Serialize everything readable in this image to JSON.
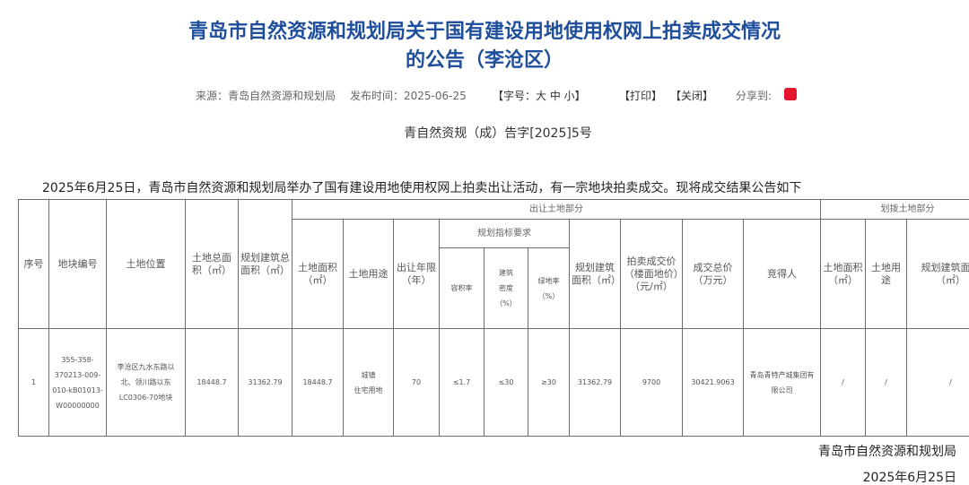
{
  "article": {
    "title_line1": "青岛市自然资源和规划局关于国有建设用地使用权网上拍卖成交情况",
    "title_line2": "的公告（李沧区）",
    "source": "来源：青岛自然资源和规划局",
    "publish_time": "发布时间：2025-06-25",
    "font_size_label": "【字号：大 中 小】",
    "print_label": "【打印】",
    "close_label": "【关闭】",
    "share_label": "分享到:",
    "share_icons": [
      "wechat-icon",
      "qzone-icon",
      "weibo-icon"
    ],
    "doc_number": "青自然资规（成）告字[2025]5号",
    "intro": "2025年6月25日，青岛市自然资源和规划局举办了国有建设用地使用权网上拍卖出让活动，有一宗地块拍卖成交。现将成交结果公告如下",
    "footer_org": "青岛市自然资源和规划局",
    "footer_date": "2025年6月25日"
  },
  "table": {
    "group_transfer": "出让土地部分",
    "group_allocate": "划拨土地部分",
    "group_planning": "规划指标要求",
    "h_seq": "序号",
    "h_parcel_no": "地块编号",
    "h_location": "土地位置",
    "h_total_area": "土地总面积（㎡）",
    "h_total_build": "规划建筑总面积（㎡）",
    "h_area": "土地面积（㎡）",
    "h_use": "土地用途",
    "h_years": "出让年限（年）",
    "h_far": "容积率",
    "h_density_a": "建筑",
    "h_density_b": "密度",
    "h_density_c": "（%）",
    "h_green_a": "绿地率",
    "h_green_b": "（%）",
    "h_build_area": "规划建筑面积（㎡）",
    "h_price": "拍卖成交价（楼面地价）（元/㎡）",
    "h_total_price": "成交总价（万元）",
    "h_winner": "竞得人",
    "h_a_area": "土地面积（㎡）",
    "h_a_use": "土地用途",
    "h_a_build": "规划建筑面积（㎡）",
    "row": {
      "seq": "1",
      "parcel_no_lines": [
        "355-358-",
        "370213-009-",
        "010-kB01013-",
        "W00000000"
      ],
      "location_lines": [
        "李沧区九水东路以",
        "北、领川路以东",
        "LC0306-70地块"
      ],
      "total_area": "18448.7",
      "total_build": "31362.79",
      "area": "18448.7",
      "use_lines": [
        "城镇",
        "住宅用地"
      ],
      "years": "70",
      "far": "≤1.7",
      "density": "≤30",
      "green": "≥30",
      "build_area": "31362.79",
      "price": "9700",
      "total_price": "30421.9063",
      "winner_lines": [
        "青岛青特产城集团有",
        "限公司"
      ],
      "a_area": "/",
      "a_use": "/",
      "a_build": "/"
    }
  }
}
